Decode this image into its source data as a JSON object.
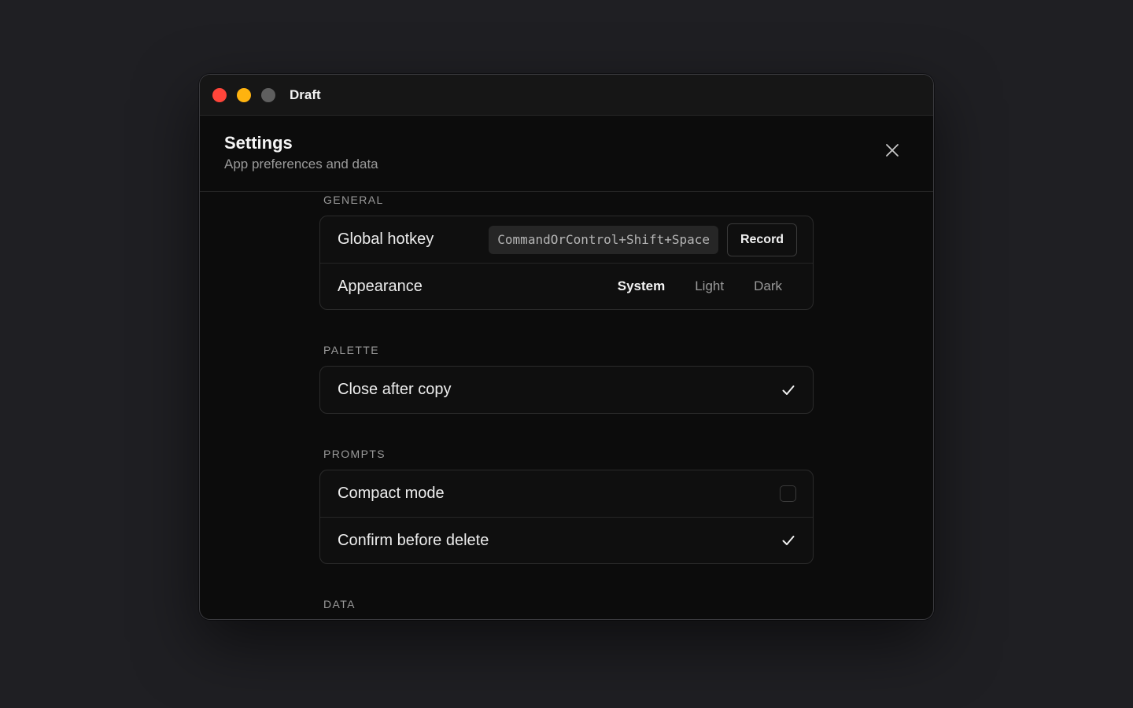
{
  "window": {
    "title": "Draft",
    "controls": [
      "close",
      "minimize",
      "zoom"
    ]
  },
  "header": {
    "title": "Settings",
    "subtitle": "App preferences and data",
    "close_icon": "close-icon"
  },
  "sections": {
    "general": {
      "label": "GENERAL",
      "hotkey": {
        "label": "Global hotkey",
        "value": "CommandOrControl+Shift+Space",
        "record_label": "Record"
      },
      "appearance": {
        "label": "Appearance",
        "options": [
          "System",
          "Light",
          "Dark"
        ],
        "selected": "System"
      }
    },
    "palette": {
      "label": "PALETTE",
      "close_after_copy": {
        "label": "Close after copy",
        "checked": true
      }
    },
    "prompts": {
      "label": "PROMPTS",
      "compact_mode": {
        "label": "Compact mode",
        "checked": false
      },
      "confirm_delete": {
        "label": "Confirm before delete",
        "checked": true
      }
    },
    "data": {
      "label": "DATA"
    }
  },
  "colors": {
    "background": "#1f1f23",
    "window": "#0c0c0c",
    "traffic_red": "#ff453a",
    "traffic_yellow": "#ffb30f",
    "traffic_gray": "#5f5f5f"
  }
}
